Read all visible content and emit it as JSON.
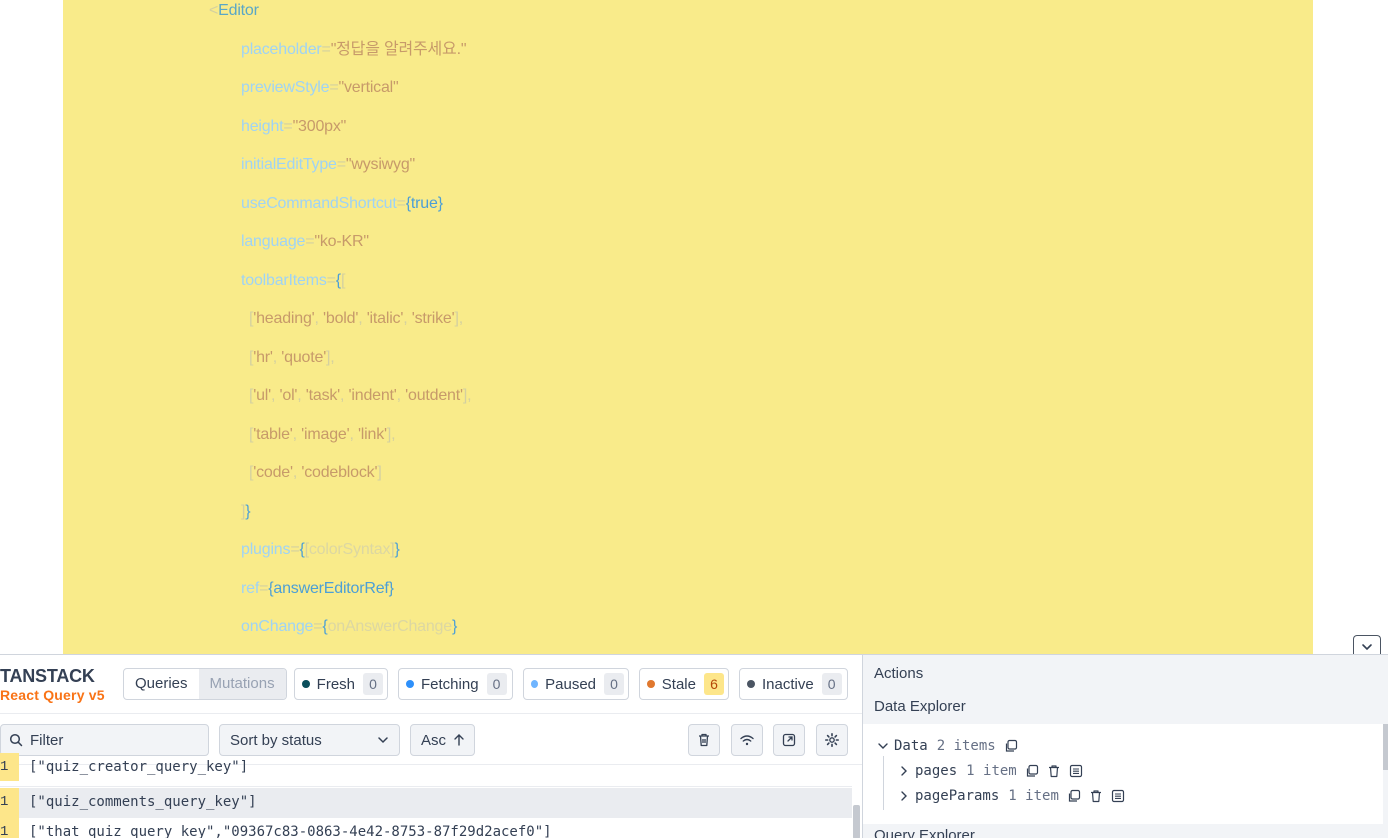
{
  "editor": {
    "lines": [
      {
        "indent": 209,
        "parts": [
          [
            "punc",
            "<"
          ],
          [
            "tag",
            "Editor"
          ]
        ]
      },
      {
        "indent": 241,
        "parts": [
          [
            "attr",
            "placeholder"
          ],
          [
            "punc",
            "="
          ],
          [
            "str",
            "\"정답을 알려주세요.\""
          ]
        ]
      },
      {
        "indent": 241,
        "parts": [
          [
            "attr",
            "previewStyle"
          ],
          [
            "punc",
            "="
          ],
          [
            "str",
            "\"vertical\""
          ]
        ]
      },
      {
        "indent": 241,
        "parts": [
          [
            "attr",
            "height"
          ],
          [
            "punc",
            "="
          ],
          [
            "str",
            "\"300px\""
          ]
        ]
      },
      {
        "indent": 241,
        "parts": [
          [
            "attr",
            "initialEditType"
          ],
          [
            "punc",
            "="
          ],
          [
            "str",
            "\"wysiwyg\""
          ]
        ]
      },
      {
        "indent": 241,
        "parts": [
          [
            "attr",
            "useCommandShortcut"
          ],
          [
            "punc",
            "="
          ],
          [
            "brace",
            "{"
          ],
          [
            "kw",
            "true"
          ],
          [
            "brace",
            "}"
          ]
        ]
      },
      {
        "indent": 241,
        "parts": [
          [
            "attr",
            "language"
          ],
          [
            "punc",
            "="
          ],
          [
            "str",
            "\"ko-KR\""
          ]
        ]
      },
      {
        "indent": 241,
        "parts": [
          [
            "attr",
            "toolbarItems"
          ],
          [
            "punc",
            "="
          ],
          [
            "brace",
            "{"
          ],
          [
            "punc",
            "["
          ]
        ]
      },
      {
        "indent": 249,
        "parts": [
          [
            "punc",
            "["
          ],
          [
            "str",
            "'heading'"
          ],
          [
            "punc",
            ", "
          ],
          [
            "str",
            "'bold'"
          ],
          [
            "punc",
            ", "
          ],
          [
            "str",
            "'italic'"
          ],
          [
            "punc",
            ", "
          ],
          [
            "str",
            "'strike'"
          ],
          [
            "punc",
            "],"
          ]
        ]
      },
      {
        "indent": 249,
        "parts": [
          [
            "punc",
            "["
          ],
          [
            "str",
            "'hr'"
          ],
          [
            "punc",
            ", "
          ],
          [
            "str",
            "'quote'"
          ],
          [
            "punc",
            "],"
          ]
        ]
      },
      {
        "indent": 249,
        "parts": [
          [
            "punc",
            "["
          ],
          [
            "str",
            "'ul'"
          ],
          [
            "punc",
            ", "
          ],
          [
            "str",
            "'ol'"
          ],
          [
            "punc",
            ", "
          ],
          [
            "str",
            "'task'"
          ],
          [
            "punc",
            ", "
          ],
          [
            "str",
            "'indent'"
          ],
          [
            "punc",
            ", "
          ],
          [
            "str",
            "'outdent'"
          ],
          [
            "punc",
            "],"
          ]
        ]
      },
      {
        "indent": 249,
        "parts": [
          [
            "punc",
            "["
          ],
          [
            "str",
            "'table'"
          ],
          [
            "punc",
            ", "
          ],
          [
            "str",
            "'image'"
          ],
          [
            "punc",
            ", "
          ],
          [
            "str",
            "'link'"
          ],
          [
            "punc",
            "],"
          ]
        ]
      },
      {
        "indent": 249,
        "parts": [
          [
            "punc",
            "["
          ],
          [
            "str",
            "'code'"
          ],
          [
            "punc",
            ", "
          ],
          [
            "str",
            "'codeblock'"
          ],
          [
            "punc",
            "]"
          ]
        ]
      },
      {
        "indent": 241,
        "parts": [
          [
            "punc",
            "]"
          ],
          [
            "brace",
            "}"
          ]
        ]
      },
      {
        "indent": 241,
        "parts": [
          [
            "attr",
            "plugins"
          ],
          [
            "punc",
            "="
          ],
          [
            "brace",
            "{"
          ],
          [
            "punc",
            "["
          ],
          [
            "dim",
            "colorSyntax"
          ],
          [
            "punc",
            "]"
          ],
          [
            "brace",
            "}"
          ]
        ]
      },
      {
        "indent": 241,
        "parts": [
          [
            "attr",
            "ref"
          ],
          [
            "punc",
            "="
          ],
          [
            "brace",
            "{"
          ],
          [
            "kw",
            "answerEditorRef"
          ],
          [
            "brace",
            "}"
          ]
        ]
      },
      {
        "indent": 241,
        "parts": [
          [
            "attr",
            "onChange"
          ],
          [
            "punc",
            "="
          ],
          [
            "brace",
            "{"
          ],
          [
            "dim",
            "onAnswerChange"
          ],
          [
            "brace",
            "}"
          ]
        ]
      }
    ]
  },
  "devtools": {
    "logo_top": "TANSTACK",
    "logo_bottom": "React Query v5",
    "tabs": {
      "queries": "Queries",
      "mutations": "Mutations"
    },
    "statuses": [
      {
        "label": "Fresh",
        "count": "0",
        "color": "#12b76a",
        "dot": "#0b4f5c"
      },
      {
        "label": "Fetching",
        "count": "0",
        "color": "#1570ef",
        "dot": "#2e90fa"
      },
      {
        "label": "Paused",
        "count": "0",
        "color": "#7a5af8",
        "dot": "#6fb5ff"
      },
      {
        "label": "Stale",
        "count": "6",
        "color": "#f79009",
        "dot": "#e0782e"
      },
      {
        "label": "Inactive",
        "count": "0",
        "color": "#667085",
        "dot": "#4b5563"
      }
    ],
    "filter_placeholder": "Filter",
    "sort_label": "Sort by status",
    "order_label": "Asc",
    "queries": [
      {
        "observers": "1",
        "key": "[\"quiz_creator_query_key\"]"
      },
      {
        "observers": "1",
        "key": "[\"quiz_comments_query_key\"]"
      },
      {
        "observers": "1",
        "key": "[\"that_quiz_query_key\",\"09367c83-0863-4e42-8753-87f29d2acef0\"]"
      }
    ],
    "panel": {
      "actions": "Actions",
      "data_explorer": "Data Explorer",
      "query_explorer": "Query Explorer",
      "tree": {
        "root_label": "Data",
        "root_meta": "2 items",
        "children": [
          {
            "label": "pages",
            "meta": "1 item"
          },
          {
            "label": "pageParams",
            "meta": "1 item"
          }
        ]
      }
    }
  }
}
